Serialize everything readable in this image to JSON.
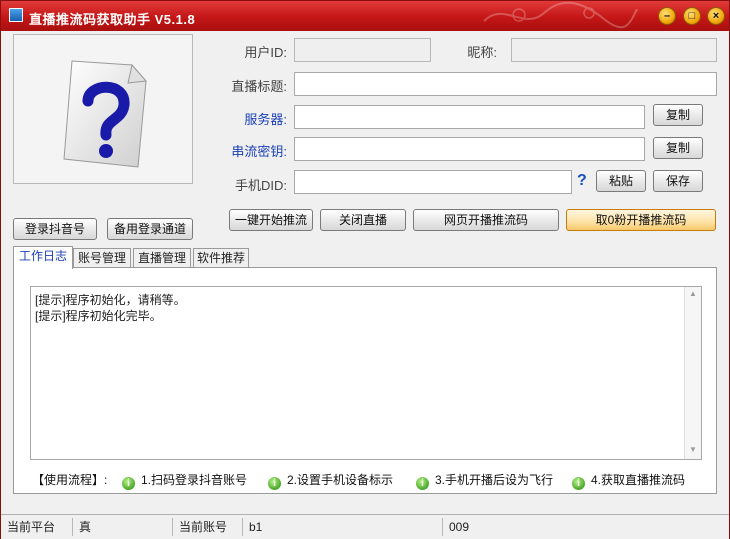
{
  "window": {
    "title": "直播推流码获取助手 V5.1.8"
  },
  "left_panel": {
    "login_button": "登录抖音号",
    "backup_login_button": "备用登录通道"
  },
  "form": {
    "user_id_label": "用户ID:",
    "user_id_value": "",
    "nickname_label": "昵称:",
    "nickname_value": "",
    "live_title_label": "直播标题:",
    "live_title_value": "",
    "server_label": "服务器:",
    "server_value": "",
    "stream_key_label": "串流密钥:",
    "stream_key_value": "",
    "device_did_label": "手机DID:",
    "device_did_value": "",
    "copy_label": "复制",
    "paste_label": "粘贴",
    "save_label": "保存"
  },
  "actions": {
    "start_push": "一键开始推流",
    "close_live": "关闭直播",
    "web_push_code": "网页开播推流码",
    "zero_fans_push_code": "取0粉开播推流码"
  },
  "tabs": [
    {
      "label": "工作日志"
    },
    {
      "label": "账号管理"
    },
    {
      "label": "直播管理"
    },
    {
      "label": "软件推荐"
    }
  ],
  "log": {
    "lines": [
      "[提示]程序初始化，请稍等。",
      "[提示]程序初始化完毕。"
    ]
  },
  "usage": {
    "title": "【使用流程】:",
    "steps": [
      "1.扫码登录抖音账号",
      "2.设置手机设备标示",
      "3.手机开播后设为飞行",
      "4.获取直播推流码"
    ]
  },
  "status": {
    "platform_label": "当前平台",
    "platform_value": "真",
    "account_label": "当前账号",
    "account_value": "b1",
    "extra_value": "009"
  }
}
